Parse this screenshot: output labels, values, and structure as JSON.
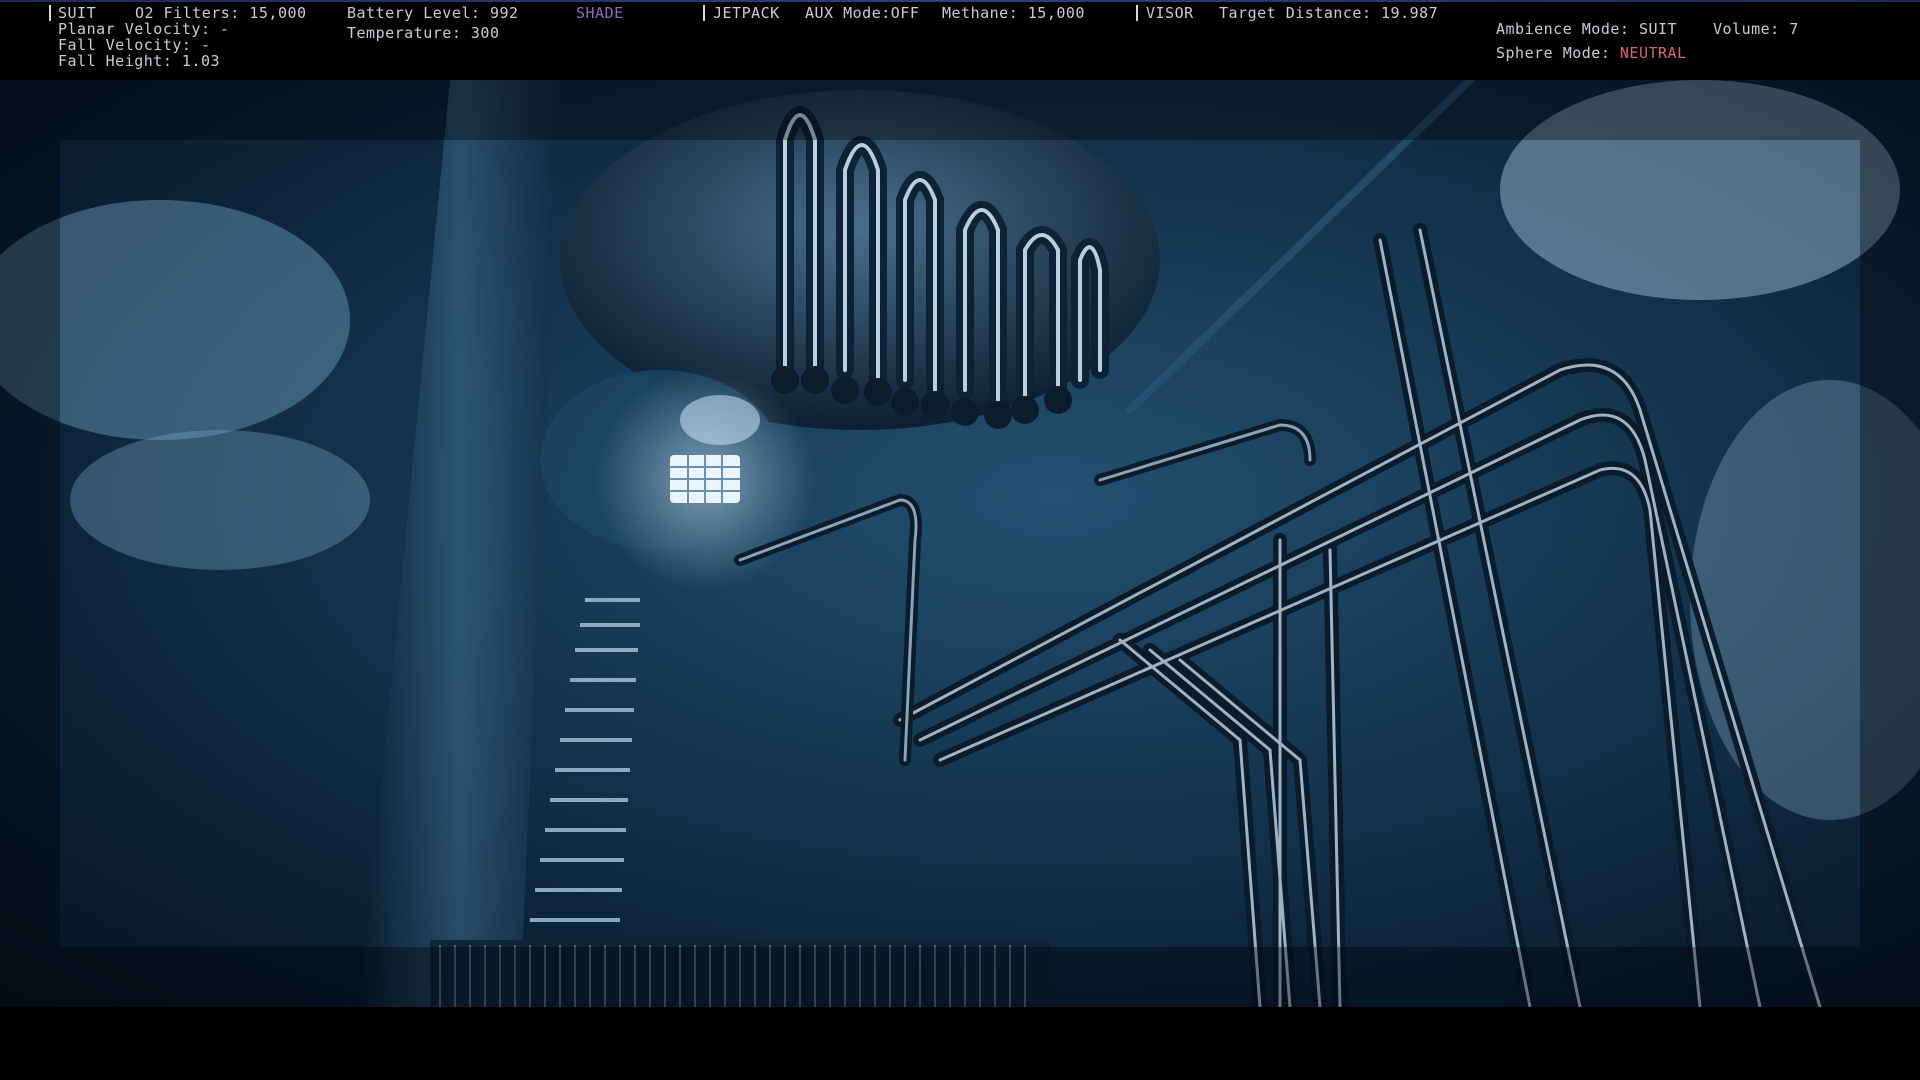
{
  "hud": {
    "suit": {
      "label": "SUIT",
      "o2_filters": "O2 Filters: 15,000",
      "planar_velocity": "Planar Velocity: -",
      "fall_velocity": "Fall Velocity: -",
      "fall_height": "Fall Height: 1.03"
    },
    "battery": {
      "level": "Battery Level: 992",
      "temperature": "Temperature: 300"
    },
    "shade": "SHADE",
    "jetpack": {
      "label": "JETPACK",
      "aux_mode": "AUX Mode:OFF",
      "methane": "Methane: 15,000"
    },
    "visor": {
      "label": "VISOR",
      "target_distance": "Target Distance: 19.987"
    },
    "ambience": {
      "mode": "Ambience Mode: SUIT",
      "volume": "Volume: 7",
      "sphere_mode_label": "Sphere Mode: ",
      "sphere_mode_value": "NEUTRAL"
    }
  },
  "colors": {
    "hud_text": "#c9cdd4",
    "shade": "#8a6cc9",
    "neutral": "#d76a5e",
    "scene_tint": "#163a55"
  }
}
